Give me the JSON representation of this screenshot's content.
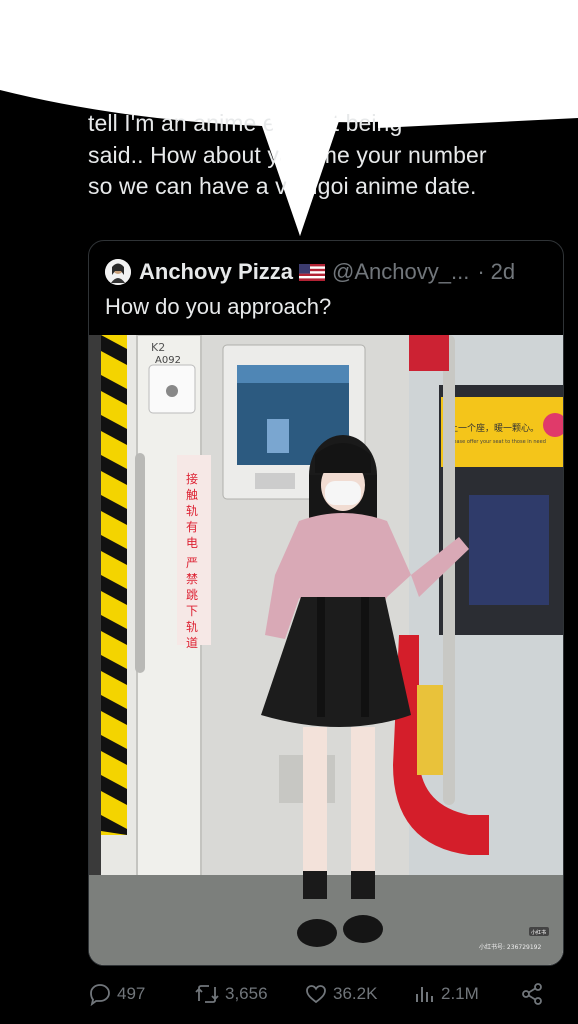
{
  "tweet": {
    "lines": [
      "tell I'm an anime exp           nat being",
      "said.. How about yo        e me your number",
      "so we can have a v       sugoi anime date."
    ]
  },
  "quote": {
    "name": "Anchovy Pizza",
    "handle": "@Anchovy_...",
    "separator": "·",
    "time": "2d",
    "text": "How do you approach?"
  },
  "photo": {
    "train_code_top": "K2",
    "train_code": "A092",
    "train_code_sub": "2",
    "warning_sign": [
      "接",
      "触",
      "轨",
      "有",
      "电"
    ],
    "warning_sign_2": [
      "严",
      "禁",
      "跳",
      "下",
      "轨",
      "道"
    ],
    "ad_text": "让一个座，暖一颗心。",
    "ad_text_en": "Please offer your seat to those in need",
    "watermark_app": "小红书",
    "watermark_id": "小红书号: 236729192"
  },
  "actions": {
    "replies": "497",
    "reposts": "3,656",
    "likes": "36.2K",
    "views": "2.1M"
  },
  "colors": {
    "background": "#000000",
    "text": "#e7e9ea",
    "muted": "#71767b",
    "border": "#2f3336"
  }
}
